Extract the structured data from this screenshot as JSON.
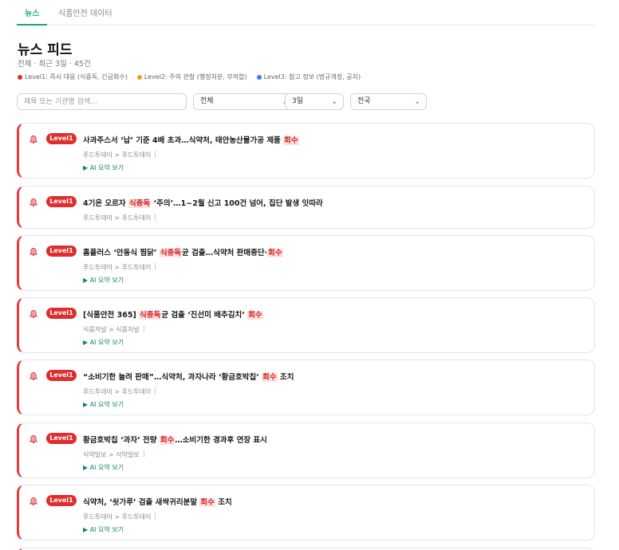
{
  "tabs": [
    {
      "label": "뉴스",
      "active": true
    },
    {
      "label": "식품안전 데이터",
      "active": false
    }
  ],
  "page": {
    "title": "뉴스 피드",
    "meta": "전체 · 최근 3일 · 45건"
  },
  "legend": [
    {
      "label": "Level1: 즉시 대응 (식중독, 긴급회수)",
      "color": "#e02d2d"
    },
    {
      "label": "Level2: 주의 관찰 (행정처분, 부적합)",
      "color": "#f0a020"
    },
    {
      "label": "Level3: 참고 정보 (법규개정, 공지)",
      "color": "#2f7ee8"
    }
  ],
  "filters": {
    "search_placeholder": "제목 또는 기관명 검색...",
    "category": "전체",
    "period": "3일",
    "region": "전국"
  },
  "accent_color": "#17a389",
  "level1_color": "#e02d2d",
  "news": [
    {
      "level": "Level1",
      "parts": [
        "사과주스서 ‘납’ 기준 4배 초과…식약처, 태안농산물가공 제품 ",
        "회수",
        ""
      ],
      "source": "푸드투데이 > 푸드투데이",
      "ai": "▶ AI 요약 보기"
    },
    {
      "level": "Level1",
      "parts": [
        "4기온 오르자 ",
        "식중독",
        " ‘주의’…1~2월 신고 100건 넘어, 집단 발생 잇따라"
      ],
      "source": "푸드투데이 > 푸드투데이",
      "ai": ""
    },
    {
      "level": "Level1",
      "parts": [
        "홈플러스 ‘안동식 찜닭’ ",
        "식중독",
        "균 검출…식약처 판매중단·",
        "회수",
        ""
      ],
      "source": "푸드투데이 > 푸드투데이",
      "ai": "▶ AI 요약 보기"
    },
    {
      "level": "Level1",
      "parts": [
        "[식품안전 365] ",
        "식중독",
        "균 검출 ‘진선미 배추김치’ ",
        "회수",
        ""
      ],
      "source": "식품저널 > 식품저널",
      "ai": "▶ AI 요약 보기"
    },
    {
      "level": "Level1",
      "parts": [
        "“소비기한 늘려 판매”…식약처, 과자나라 ‘황금호박칩’ ",
        "회수",
        " 조치"
      ],
      "source": "푸드투데이 > 푸드투데이",
      "ai": "▶ AI 요약 보기"
    },
    {
      "level": "Level1",
      "parts": [
        "황금호박칩 ‘과자’ 전량 ",
        "회수",
        "…소비기한 경과후 연장 표시"
      ],
      "source": "식약일보 > 식약일보",
      "ai": "▶ AI 요약 보기"
    },
    {
      "level": "Level1",
      "parts": [
        "식약처, ‘쇳가루’ 검출 새싹귀리분말 ",
        "회수",
        " 조치"
      ],
      "source": "푸드투데이 > 푸드투데이",
      "ai": "▶ AI 요약 보기"
    }
  ]
}
